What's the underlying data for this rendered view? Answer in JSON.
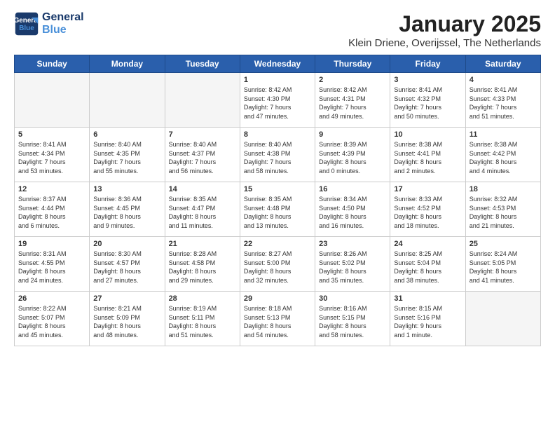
{
  "logo": {
    "line1": "General",
    "line2": "Blue"
  },
  "title": "January 2025",
  "location": "Klein Driene, Overijssel, The Netherlands",
  "weekdays": [
    "Sunday",
    "Monday",
    "Tuesday",
    "Wednesday",
    "Thursday",
    "Friday",
    "Saturday"
  ],
  "weeks": [
    [
      {
        "day": "",
        "info": ""
      },
      {
        "day": "",
        "info": ""
      },
      {
        "day": "",
        "info": ""
      },
      {
        "day": "1",
        "info": "Sunrise: 8:42 AM\nSunset: 4:30 PM\nDaylight: 7 hours\nand 47 minutes."
      },
      {
        "day": "2",
        "info": "Sunrise: 8:42 AM\nSunset: 4:31 PM\nDaylight: 7 hours\nand 49 minutes."
      },
      {
        "day": "3",
        "info": "Sunrise: 8:41 AM\nSunset: 4:32 PM\nDaylight: 7 hours\nand 50 minutes."
      },
      {
        "day": "4",
        "info": "Sunrise: 8:41 AM\nSunset: 4:33 PM\nDaylight: 7 hours\nand 51 minutes."
      }
    ],
    [
      {
        "day": "5",
        "info": "Sunrise: 8:41 AM\nSunset: 4:34 PM\nDaylight: 7 hours\nand 53 minutes."
      },
      {
        "day": "6",
        "info": "Sunrise: 8:40 AM\nSunset: 4:35 PM\nDaylight: 7 hours\nand 55 minutes."
      },
      {
        "day": "7",
        "info": "Sunrise: 8:40 AM\nSunset: 4:37 PM\nDaylight: 7 hours\nand 56 minutes."
      },
      {
        "day": "8",
        "info": "Sunrise: 8:40 AM\nSunset: 4:38 PM\nDaylight: 7 hours\nand 58 minutes."
      },
      {
        "day": "9",
        "info": "Sunrise: 8:39 AM\nSunset: 4:39 PM\nDaylight: 8 hours\nand 0 minutes."
      },
      {
        "day": "10",
        "info": "Sunrise: 8:38 AM\nSunset: 4:41 PM\nDaylight: 8 hours\nand 2 minutes."
      },
      {
        "day": "11",
        "info": "Sunrise: 8:38 AM\nSunset: 4:42 PM\nDaylight: 8 hours\nand 4 minutes."
      }
    ],
    [
      {
        "day": "12",
        "info": "Sunrise: 8:37 AM\nSunset: 4:44 PM\nDaylight: 8 hours\nand 6 minutes."
      },
      {
        "day": "13",
        "info": "Sunrise: 8:36 AM\nSunset: 4:45 PM\nDaylight: 8 hours\nand 9 minutes."
      },
      {
        "day": "14",
        "info": "Sunrise: 8:35 AM\nSunset: 4:47 PM\nDaylight: 8 hours\nand 11 minutes."
      },
      {
        "day": "15",
        "info": "Sunrise: 8:35 AM\nSunset: 4:48 PM\nDaylight: 8 hours\nand 13 minutes."
      },
      {
        "day": "16",
        "info": "Sunrise: 8:34 AM\nSunset: 4:50 PM\nDaylight: 8 hours\nand 16 minutes."
      },
      {
        "day": "17",
        "info": "Sunrise: 8:33 AM\nSunset: 4:52 PM\nDaylight: 8 hours\nand 18 minutes."
      },
      {
        "day": "18",
        "info": "Sunrise: 8:32 AM\nSunset: 4:53 PM\nDaylight: 8 hours\nand 21 minutes."
      }
    ],
    [
      {
        "day": "19",
        "info": "Sunrise: 8:31 AM\nSunset: 4:55 PM\nDaylight: 8 hours\nand 24 minutes."
      },
      {
        "day": "20",
        "info": "Sunrise: 8:30 AM\nSunset: 4:57 PM\nDaylight: 8 hours\nand 27 minutes."
      },
      {
        "day": "21",
        "info": "Sunrise: 8:28 AM\nSunset: 4:58 PM\nDaylight: 8 hours\nand 29 minutes."
      },
      {
        "day": "22",
        "info": "Sunrise: 8:27 AM\nSunset: 5:00 PM\nDaylight: 8 hours\nand 32 minutes."
      },
      {
        "day": "23",
        "info": "Sunrise: 8:26 AM\nSunset: 5:02 PM\nDaylight: 8 hours\nand 35 minutes."
      },
      {
        "day": "24",
        "info": "Sunrise: 8:25 AM\nSunset: 5:04 PM\nDaylight: 8 hours\nand 38 minutes."
      },
      {
        "day": "25",
        "info": "Sunrise: 8:24 AM\nSunset: 5:05 PM\nDaylight: 8 hours\nand 41 minutes."
      }
    ],
    [
      {
        "day": "26",
        "info": "Sunrise: 8:22 AM\nSunset: 5:07 PM\nDaylight: 8 hours\nand 45 minutes."
      },
      {
        "day": "27",
        "info": "Sunrise: 8:21 AM\nSunset: 5:09 PM\nDaylight: 8 hours\nand 48 minutes."
      },
      {
        "day": "28",
        "info": "Sunrise: 8:19 AM\nSunset: 5:11 PM\nDaylight: 8 hours\nand 51 minutes."
      },
      {
        "day": "29",
        "info": "Sunrise: 8:18 AM\nSunset: 5:13 PM\nDaylight: 8 hours\nand 54 minutes."
      },
      {
        "day": "30",
        "info": "Sunrise: 8:16 AM\nSunset: 5:15 PM\nDaylight: 8 hours\nand 58 minutes."
      },
      {
        "day": "31",
        "info": "Sunrise: 8:15 AM\nSunset: 5:16 PM\nDaylight: 9 hours\nand 1 minute."
      },
      {
        "day": "",
        "info": ""
      }
    ]
  ]
}
